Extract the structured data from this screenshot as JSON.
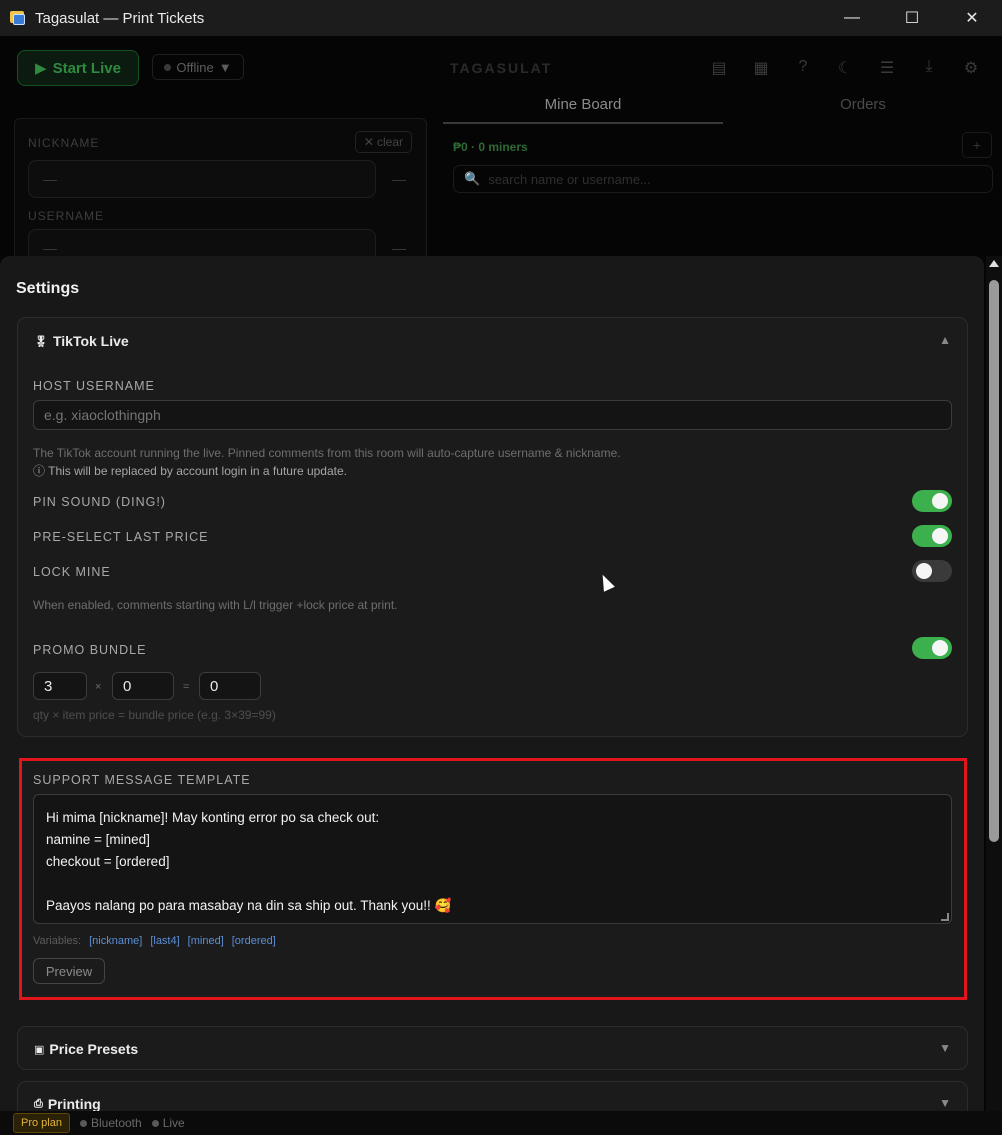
{
  "window": {
    "title": "Tagasulat — Print Tickets",
    "minimize": "—",
    "maximize": "☐",
    "close": "✕"
  },
  "topbar": {
    "start_live": "Start Live",
    "start_icon": "play-icon",
    "status": "Offline",
    "status_caret": "▼",
    "brand": "TAGASULAT",
    "icons": [
      "chart-icon",
      "calendar-icon",
      "help-icon",
      "moon-icon",
      "menu-icon",
      "download-icon",
      "gear-icon"
    ]
  },
  "left_panel": {
    "nickname_label": "NICKNAME",
    "nickname_value": "—",
    "username_label": "USERNAME",
    "username_value": "—",
    "clear_label": "clear",
    "dash": "—"
  },
  "board": {
    "tabs": [
      "Mine Board",
      "Orders"
    ],
    "miners": "₱0 · 0 miners",
    "plus": "+",
    "search_placeholder": "search name or username..."
  },
  "settings": {
    "title": "Settings",
    "tiktok": {
      "header": "TikTok Live",
      "header_icon": "medal-icon",
      "host_label": "HOST USERNAME",
      "host_placeholder": "e.g. xiaoclothingph",
      "host_hint": "The TikTok account running the live. Pinned comments from this room will auto-capture username & nickname.",
      "host_note": "This will be replaced by account login in a future update.",
      "pin_sound_label": "PIN SOUND (DING!)",
      "pin_sound_on": true,
      "preselect_label": "PRE-SELECT LAST PRICE",
      "preselect_on": true,
      "lock_mine_label": "LOCK MINE",
      "lock_mine_on": false,
      "lock_mine_hint": "When enabled, comments starting with L/l trigger +lock price at print.",
      "promo_label": "PROMO BUNDLE",
      "promo_on": true,
      "promo_qty": "3",
      "promo_times": "×",
      "promo_price": "0",
      "promo_equals": "=",
      "promo_total": "0",
      "promo_hint": "qty × item price = bundle price  (e.g. 3×39=99)"
    },
    "support": {
      "label": "SUPPORT MESSAGE TEMPLATE",
      "lines": [
        "Hi mima [nickname]! May konting error po sa check out:",
        "namine = [mined]",
        "checkout = [ordered]",
        "",
        "Paayos nalang po para masabay na din sa ship out. Thank you!! 🥰"
      ],
      "variables_label": "Variables:",
      "variables": [
        "[nickname]",
        "[last4]",
        "[mined]",
        "[ordered]"
      ],
      "preview": "Preview"
    },
    "price_presets": {
      "header": "Price Presets",
      "icon": "calculator-icon"
    },
    "printing": {
      "header": "Printing",
      "icon": "printer-icon"
    }
  },
  "statusbar": {
    "plan": "Pro plan",
    "bluetooth": "Bluetooth",
    "live": "Live"
  }
}
